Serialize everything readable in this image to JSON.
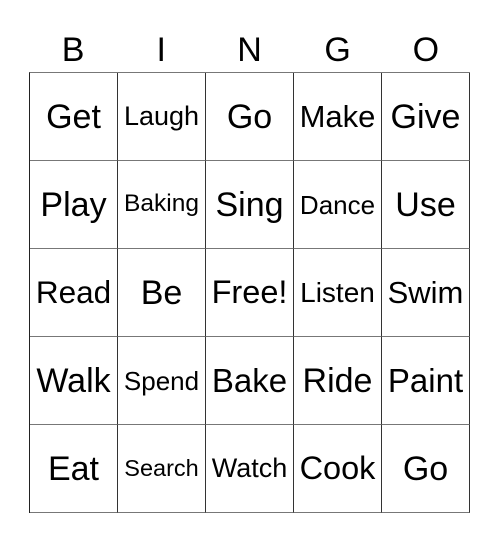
{
  "card": {
    "header_letters": [
      "B",
      "I",
      "N",
      "G",
      "O"
    ],
    "rows": [
      [
        "Get",
        "Laugh",
        "Go",
        "Make",
        "Give"
      ],
      [
        "Play",
        "Baking",
        "Sing",
        "Dance",
        "Use"
      ],
      [
        "Read",
        "Be",
        "Free!",
        "Listen",
        "Swim"
      ],
      [
        "Walk",
        "Spend",
        "Bake",
        "Ride",
        "Paint"
      ],
      [
        "Eat",
        "Search",
        "Watch",
        "Cook",
        "Go"
      ]
    ],
    "free_space_label": "Free!"
  },
  "colors": {
    "text": "#000000",
    "background": "#ffffff",
    "grid_line_vertical": "#333333",
    "grid_line_horizontal": "#777777"
  }
}
